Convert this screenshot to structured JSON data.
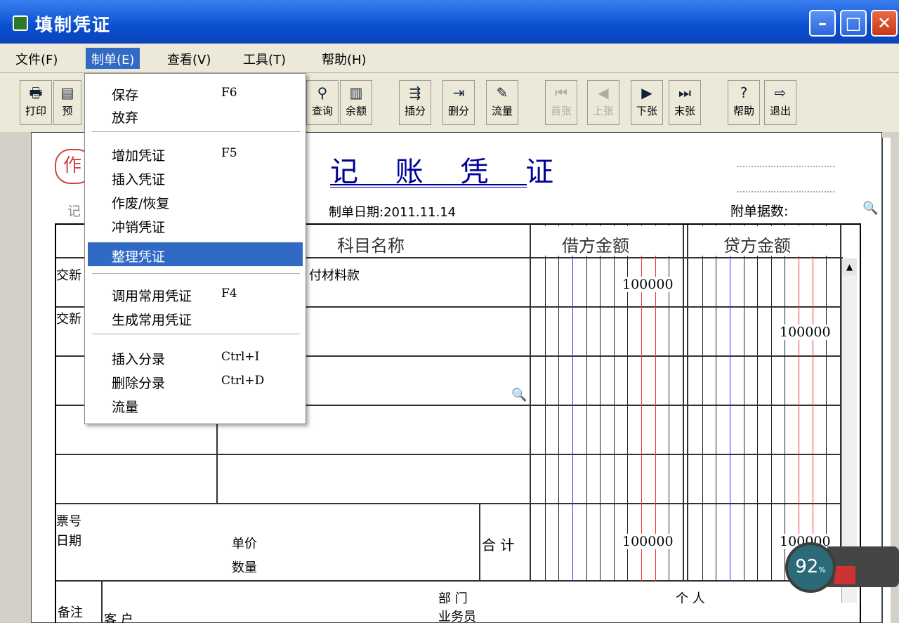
{
  "window": {
    "title": "填制凭证"
  },
  "menubar": {
    "items": [
      {
        "label": "文件(F)"
      },
      {
        "label": "制单(E)"
      },
      {
        "label": "查看(V)"
      },
      {
        "label": "工具(T)"
      },
      {
        "label": "帮助(H)"
      }
    ]
  },
  "toolbar": {
    "buttons": [
      {
        "label": "打印",
        "icon": "printer-icon",
        "glyph": "🖶",
        "enabled": true
      },
      {
        "label": "预",
        "icon": "preview-icon",
        "glyph": "▤",
        "enabled": true
      },
      {
        "label": "查询",
        "icon": "binoculars-icon",
        "glyph": "⚲",
        "enabled": true
      },
      {
        "label": "余额",
        "icon": "bar-chart-icon",
        "glyph": "▥",
        "enabled": true
      },
      {
        "label": "插分",
        "icon": "insert-split-icon",
        "glyph": "⇶",
        "enabled": true
      },
      {
        "label": "删分",
        "icon": "delete-split-icon",
        "glyph": "⇥",
        "enabled": true
      },
      {
        "label": "流量",
        "icon": "flow-icon",
        "glyph": "✎",
        "enabled": true
      },
      {
        "label": "首张",
        "icon": "first-page-icon",
        "glyph": "⏮",
        "enabled": false
      },
      {
        "label": "上张",
        "icon": "prev-page-icon",
        "glyph": "◀",
        "enabled": false
      },
      {
        "label": "下张",
        "icon": "next-page-icon",
        "glyph": "▶",
        "enabled": true
      },
      {
        "label": "末张",
        "icon": "last-page-icon",
        "glyph": "⏭",
        "enabled": true
      },
      {
        "label": "帮助",
        "icon": "help-icon",
        "glyph": "?",
        "enabled": true
      },
      {
        "label": "退出",
        "icon": "exit-icon",
        "glyph": "⇨",
        "enabled": true
      }
    ]
  },
  "dropdown": {
    "groups": [
      [
        {
          "label": "保存",
          "shortcut": "F6"
        },
        {
          "label": "放弃",
          "shortcut": ""
        }
      ],
      [
        {
          "label": "增加凭证",
          "shortcut": "F5"
        },
        {
          "label": "插入凭证",
          "shortcut": ""
        },
        {
          "label": "作废/恢复",
          "shortcut": ""
        },
        {
          "label": "冲销凭证",
          "shortcut": ""
        },
        {
          "label": "整理凭证",
          "shortcut": "",
          "highlighted": true
        }
      ],
      [
        {
          "label": "调用常用凭证",
          "shortcut": "F4"
        },
        {
          "label": "生成常用凭证",
          "shortcut": ""
        }
      ],
      [
        {
          "label": "插入分录",
          "shortcut": "Ctrl+I"
        },
        {
          "label": "删除分录",
          "shortcut": "Ctrl+D"
        },
        {
          "label": "流量",
          "shortcut": ""
        }
      ]
    ]
  },
  "voucher": {
    "stamp": "作",
    "title": "记 账 凭 证",
    "date_label": "制单日期:2011.11.14",
    "attach_label": "附单据数:",
    "left_cut_label": "记",
    "headers": {
      "subject": "科目名称",
      "debit": "借方金额",
      "credit": "贷方金额"
    },
    "rows": [
      {
        "summary": "交新",
        "subject": "付材料款",
        "debit": "100000",
        "credit": ""
      },
      {
        "summary": "交新",
        "subject": "",
        "debit": "",
        "credit": "100000"
      }
    ],
    "footer": {
      "ticket_no": "票号",
      "date": "日期",
      "unit_price": "单价",
      "quantity": "数量",
      "total_label": "合 计",
      "total_debit": "100000",
      "total_credit": "100000",
      "remark": "备注",
      "customer": "客  户",
      "department": "部  门",
      "salesperson": "业务员",
      "person": "个  人"
    }
  },
  "perf_widget": {
    "percent": "92",
    "unit": "%"
  }
}
